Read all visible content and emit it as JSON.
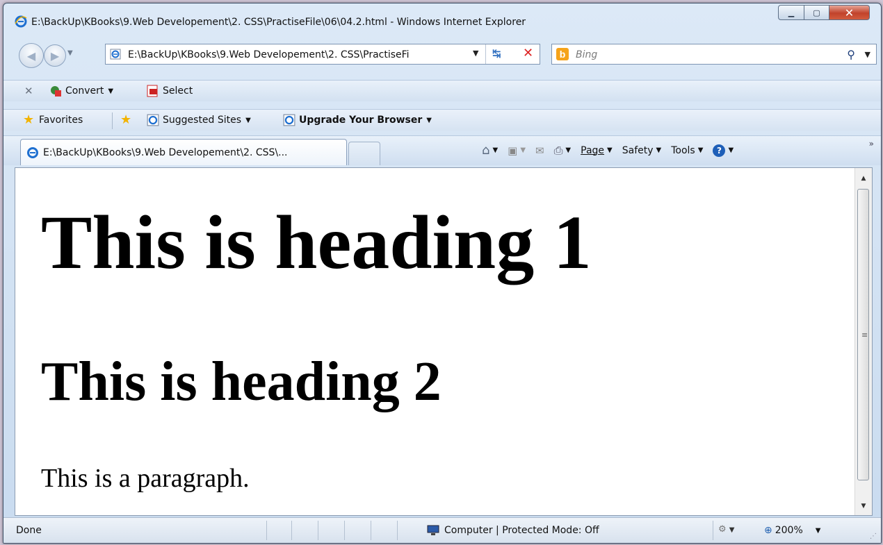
{
  "window": {
    "title": "E:\\BackUp\\KBooks\\9.Web Developement\\2. CSS\\PractiseFile\\06\\04.2.html - Windows Internet Explorer"
  },
  "nav": {
    "address": "E:\\BackUp\\KBooks\\9.Web Developement\\2. CSS\\PractiseFi",
    "search_placeholder": "Bing"
  },
  "toolbar": {
    "convert_label": "Convert",
    "select_label": "Select"
  },
  "favorites": {
    "favorites_label": "Favorites",
    "suggested_label": "Suggested Sites",
    "upgrade_label": "Upgrade Your Browser"
  },
  "tabs": [
    {
      "label": "E:\\BackUp\\KBooks\\9.Web Developement\\2. CSS\\..."
    }
  ],
  "command_bar": {
    "page": "Page",
    "safety": "Safety",
    "tools": "Tools"
  },
  "content": {
    "heading1": "This is heading 1",
    "heading2": "This is heading 2",
    "paragraph": "This is a paragraph."
  },
  "status": {
    "done": "Done",
    "zone": "Computer | Protected Mode: Off",
    "zoom": "200%"
  },
  "colors": {
    "ie_blue": "#1e6fd0",
    "close_red": "#c1432b",
    "bing_orange": "#f5a31a"
  }
}
